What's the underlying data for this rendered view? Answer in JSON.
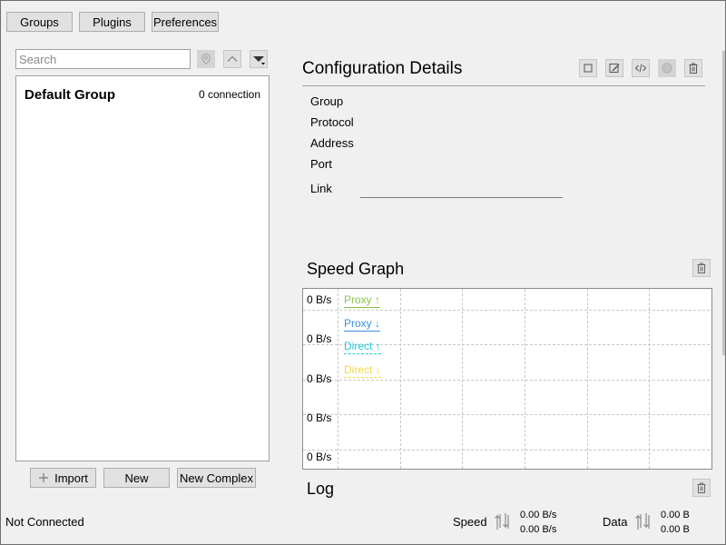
{
  "toolbar": {
    "groups_label": "Groups",
    "plugins_label": "Plugins",
    "preferences_label": "Preferences"
  },
  "search": {
    "placeholder": "Search",
    "value": ""
  },
  "search_actions": {
    "locate_icon": "locate-icon",
    "move_up_icon": "chevron-up-icon",
    "menu_icon": "dropdown-menu-icon"
  },
  "groups": [
    {
      "name": "Default Group",
      "count": "0 connection"
    }
  ],
  "left_buttons": {
    "import_label": "Import",
    "new_label": "New",
    "new_complex_label": "New Complex"
  },
  "config": {
    "title": "Configuration Details",
    "actions": [
      "select-icon",
      "edit-icon",
      "code-icon",
      "fingerprint-icon",
      "trash-icon"
    ],
    "fields": {
      "group": "Group",
      "protocol": "Protocol",
      "address": "Address",
      "port": "Port",
      "link": "Link"
    },
    "link_value": ""
  },
  "speed_graph": {
    "title": "Speed Graph"
  },
  "chart_data": {
    "type": "line",
    "title": "Speed Graph",
    "xlabel": "",
    "ylabel": "",
    "yticks": [
      "0 B/s",
      "0 B/s",
      "0 B/s",
      "0 B/s",
      "0 B/s"
    ],
    "grid": true,
    "legend_position": "top-left",
    "series": [
      {
        "name": "Proxy ↑",
        "color": "#8bc34a",
        "style": "solid",
        "values": []
      },
      {
        "name": "Proxy ↓",
        "color": "#3d8fe0",
        "style": "solid",
        "values": []
      },
      {
        "name": "Direct ↑",
        "color": "#26c6da",
        "style": "dashed",
        "values": []
      },
      {
        "name": "Direct ↓",
        "color": "#f0d94a",
        "style": "dashed",
        "values": []
      }
    ]
  },
  "log": {
    "title": "Log"
  },
  "statusbar": {
    "connection_status": "Not Connected",
    "speed_label": "Speed",
    "speed_up": "0.00 B/s",
    "speed_down": "0.00 B/s",
    "data_label": "Data",
    "data_up": "0.00 B",
    "data_down": "0.00 B"
  }
}
